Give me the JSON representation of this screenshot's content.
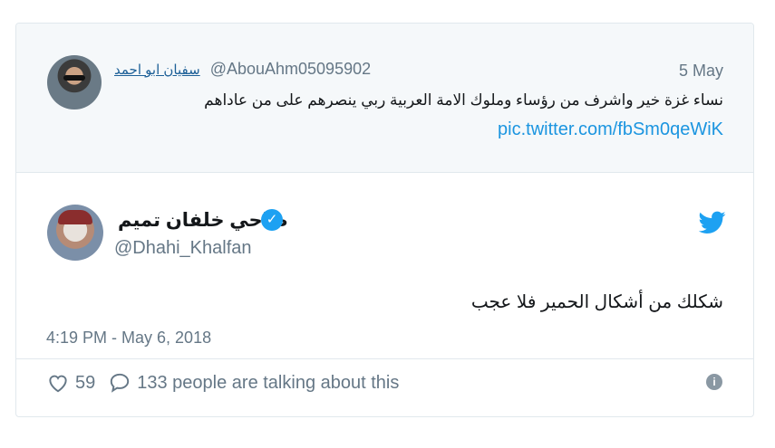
{
  "quoted_tweet": {
    "display_name": "سفيان ابو احمد",
    "handle": "@AbouAhm05095902",
    "date": "5 May",
    "text": "نساء غزة خير واشرف من رؤساء وملوك الامة العربية ربي ينصرهم على من عاداهم",
    "link": "pic.twitter.com/fbSm0qeWiK"
  },
  "tweet": {
    "author_name": "ضاحي خلفان تميم",
    "handle": "@Dhahi_Khalfan",
    "text": "شكلك من أشكال الحمير فلا عجب",
    "timestamp": "4:19 PM - May 6, 2018",
    "likes": "59",
    "talking": "133 people are talking about this"
  },
  "colors": {
    "accent": "#1da1f2",
    "link": "#1b95e0",
    "muted": "#657786",
    "quoted_bg": "#f5f8fa"
  },
  "icons": {
    "verified": "verified-badge-icon",
    "logo": "twitter-bird-icon",
    "like": "heart-icon",
    "reply": "speech-bubble-icon",
    "info": "info-icon"
  }
}
